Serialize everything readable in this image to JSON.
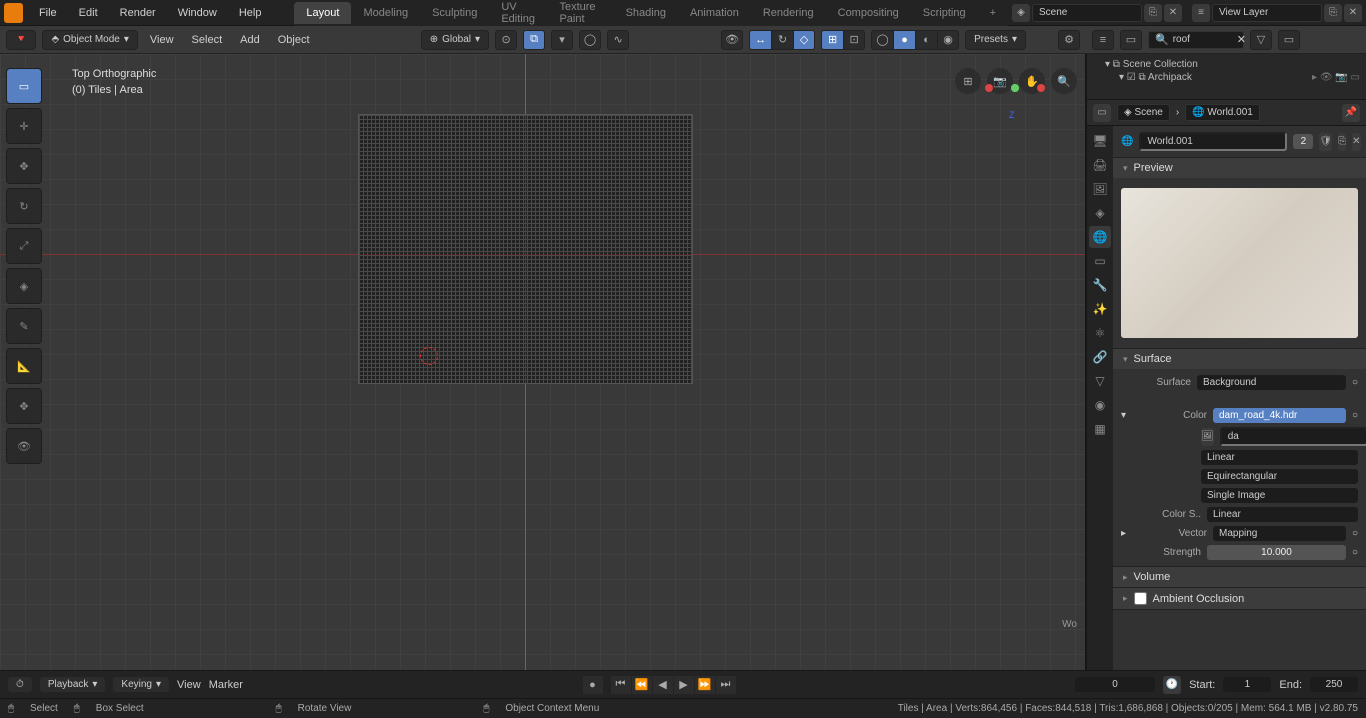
{
  "menu": {
    "file": "File",
    "edit": "Edit",
    "render": "Render",
    "window": "Window",
    "help": "Help"
  },
  "tabs": [
    "Layout",
    "Modeling",
    "Sculpting",
    "UV Editing",
    "Texture Paint",
    "Shading",
    "Animation",
    "Rendering",
    "Compositing",
    "Scripting"
  ],
  "active_tab": 0,
  "scene_field": "Scene",
  "viewlayer_field": "View Layer",
  "toolbar": {
    "mode": "Object Mode",
    "view": "View",
    "select": "Select",
    "add": "Add",
    "object": "Object",
    "orientation": "Global",
    "presets": "Presets"
  },
  "viewport": {
    "proj": "Top Orthographic",
    "info": "(0) Tiles | Area"
  },
  "outliner": {
    "root": "Scene Collection",
    "child": "Archipack",
    "search": "roof"
  },
  "props_header": {
    "scene": "Scene",
    "world": "World.001"
  },
  "world": {
    "name": "World.001",
    "users": "2",
    "sections": {
      "preview": "Preview",
      "surface": "Surface",
      "volume": "Volume",
      "ao": "Ambient Occlusion"
    },
    "surface": {
      "surface_label": "Surface",
      "surface_value": "Background",
      "color_label": "Color",
      "color_value": "dam_road_4k.hdr",
      "img_prefix": "da",
      "interp": "Linear",
      "projection": "Equirectangular",
      "source": "Single Image",
      "colorspace_label": "Color S..",
      "colorspace_value": "Linear",
      "vector_label": "Vector",
      "vector_value": "Mapping",
      "strength_label": "Strength",
      "strength_value": "10.000"
    }
  },
  "timeline": {
    "playback": "Playback",
    "keying": "Keying",
    "view": "View",
    "marker": "Marker",
    "current": "0",
    "start_label": "Start:",
    "start": "1",
    "end_label": "End:",
    "end": "250"
  },
  "status": {
    "select": "Select",
    "boxselect": "Box Select",
    "rotate": "Rotate View",
    "ctxmenu": "Object Context Menu",
    "stats": "Tiles | Area | Verts:864,456 | Faces:844,518 | Tris:1,686,868 | Objects:0/205 | Mem: 564.1 MB | v2.80.75"
  }
}
